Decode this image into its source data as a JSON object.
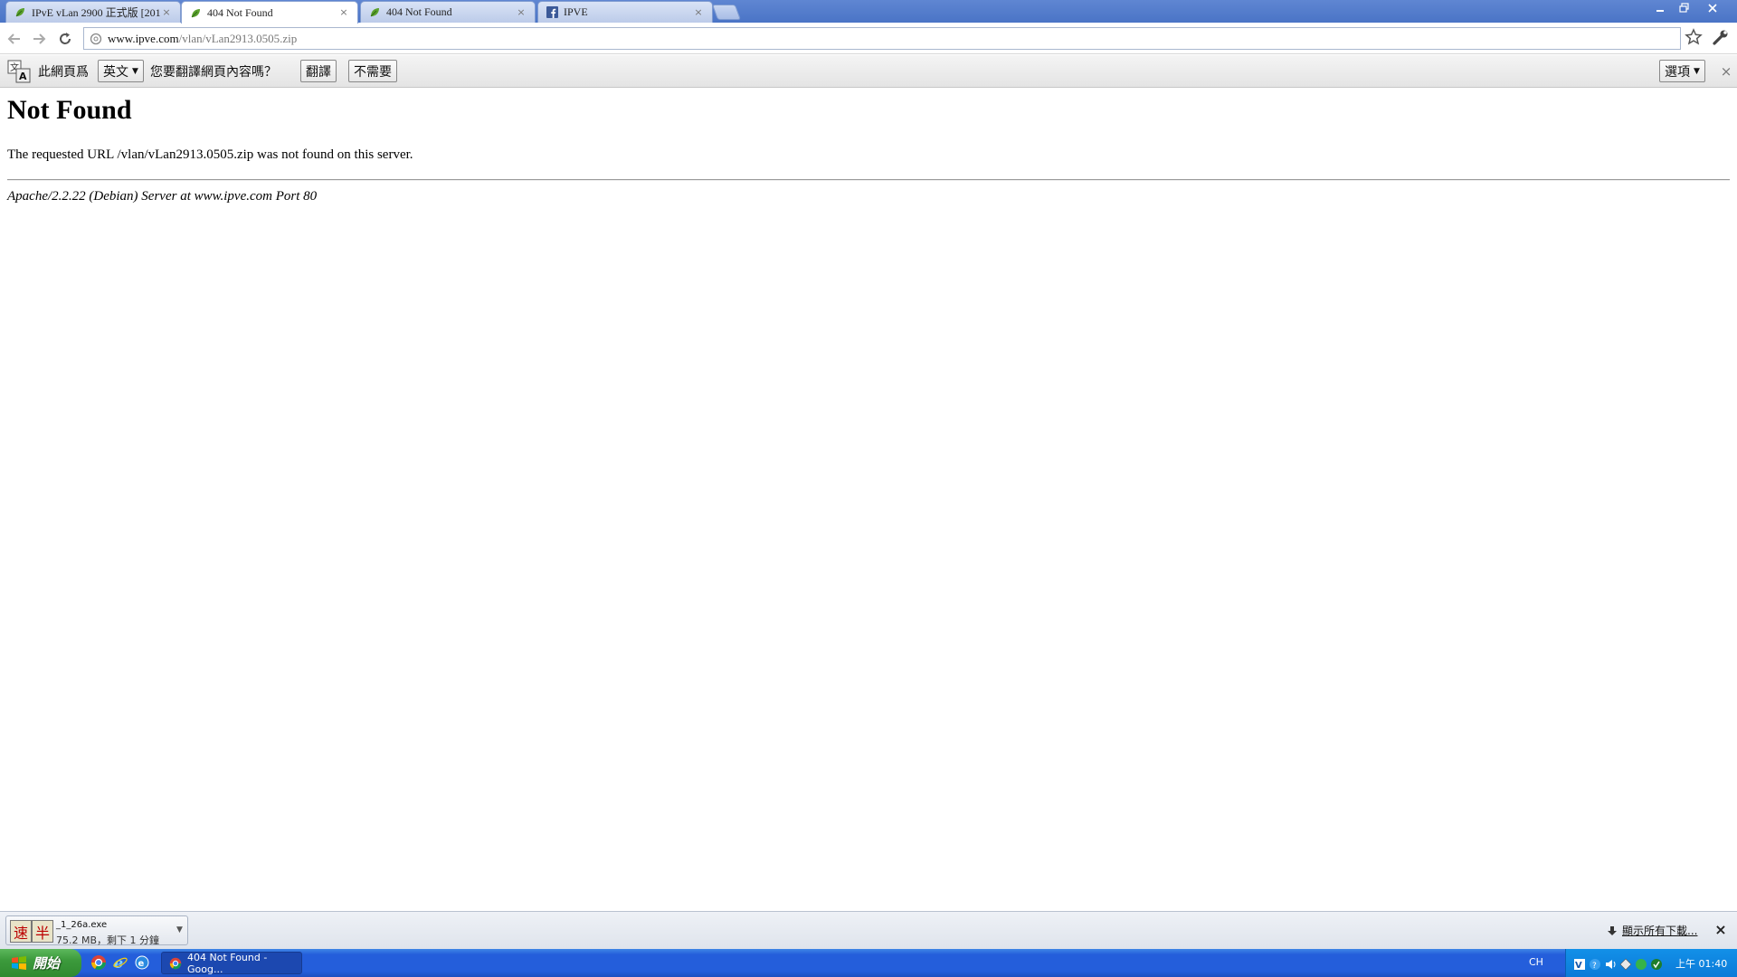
{
  "window": {
    "tabs": [
      {
        "title": "IPvE vLan 2900 正式版 [201",
        "active": false,
        "favicon": "ipve-leaf-icon"
      },
      {
        "title": "404 Not Found",
        "active": true,
        "favicon": "ipve-leaf-icon"
      },
      {
        "title": "404 Not Found",
        "active": false,
        "favicon": "ipve-leaf-icon"
      },
      {
        "title": "IPVE",
        "active": false,
        "favicon": "facebook-icon"
      }
    ],
    "close_glyph": "×"
  },
  "toolbar": {
    "url_host": "www.ipve.com",
    "url_path": "/vlan/vLan2913.0505.zip"
  },
  "translate_bar": {
    "prefix": "此網頁爲",
    "language": "英文",
    "question": "您要翻譯網頁內容嗎？",
    "translate_label": "翻譯",
    "nope_label": "不需要",
    "options_label": "選項"
  },
  "page": {
    "heading": "Not Found",
    "message": "The requested URL /vlan/vLan2913.0505.zip was not found on this server.",
    "server_signature": "Apache/2.2.22 (Debian) Server at www.ipve.com Port 80"
  },
  "download_shelf": {
    "ime_1": "速",
    "ime_2": "半",
    "filename": "_1_26a.exe",
    "status": "75.2 MB，剩下 1 分鐘",
    "show_all_label": "顯示所有下載..."
  },
  "taskbar": {
    "start_label": "開始",
    "task_item_label": "404 Not Found - Goog...",
    "language_indicator": "CH",
    "clock": "上午 01:40"
  },
  "colors": {
    "taskbar_blue": "#245edb",
    "start_green": "#3c9a3c",
    "tray_blue": "#0c7ad8"
  }
}
